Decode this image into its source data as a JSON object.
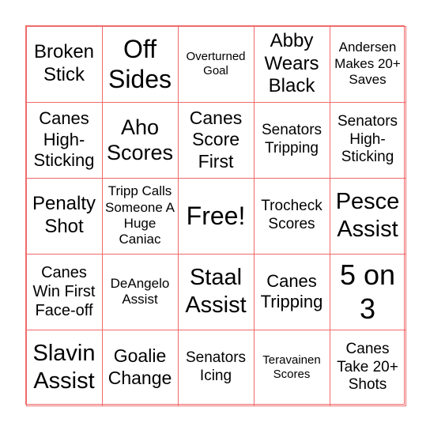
{
  "card": {
    "border_color": "#f06a6a",
    "cells": [
      "Broken Stick",
      "Off Sides",
      "Overturned Goal",
      "Abby Wears Black",
      "Andersen Makes 20+ Saves",
      "Canes High-Sticking",
      "Aho Scores",
      "Canes Score First",
      "Senators Tripping",
      "Senators High-Sticking",
      "Penalty Shot",
      "Tripp Calls Someone A Huge Caniac",
      "Free!",
      "Trocheck Scores",
      "Pesce Assist",
      "Canes Win First Face-off",
      "DeAngelo Assist",
      "Staal Assist",
      "Canes Tripping",
      "5 on 3",
      "Slavin Assist",
      "Goalie Change",
      "Senators Icing",
      "Teravainen Scores",
      "Canes Take 20+ Shots"
    ]
  }
}
